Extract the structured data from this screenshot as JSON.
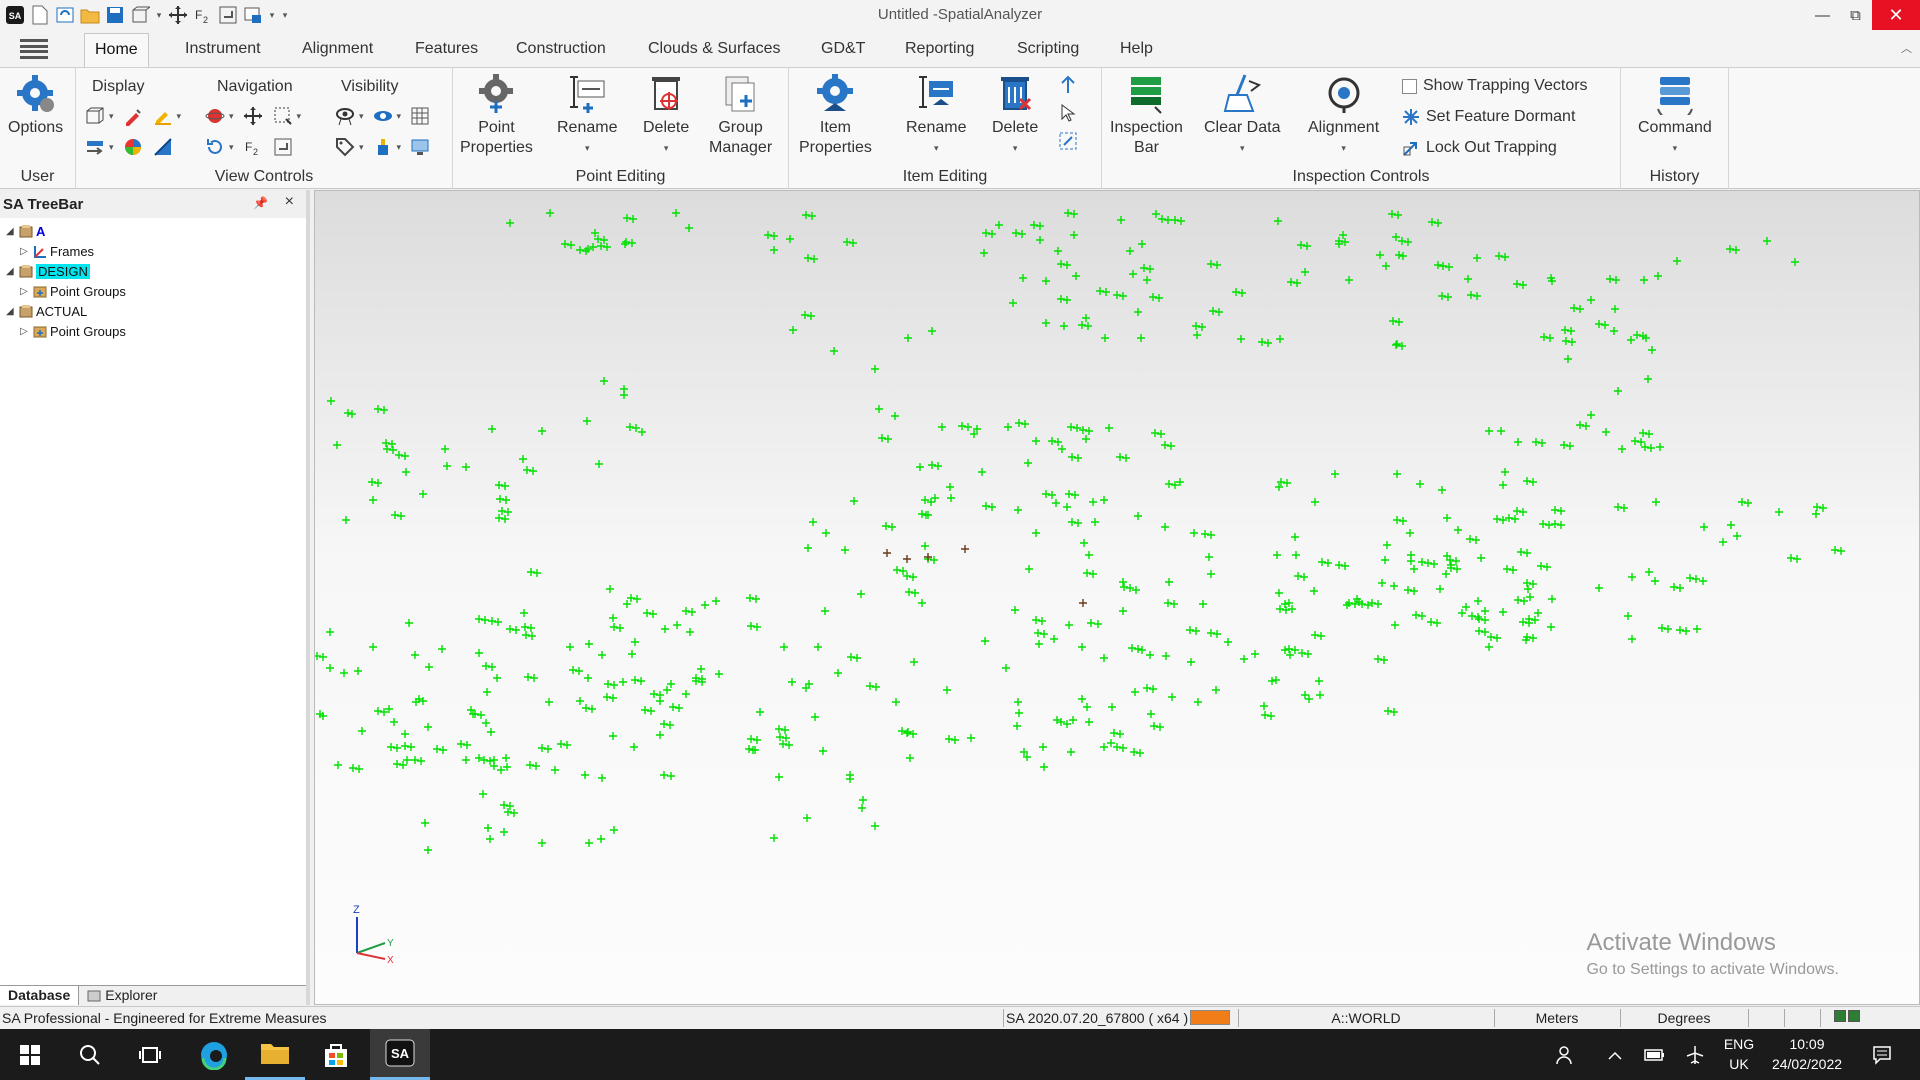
{
  "window": {
    "title": "Untitled -SpatialAnalyzer",
    "close_glyph": "✕",
    "max_glyph": "⧉",
    "min_glyph": "—"
  },
  "tabs": [
    "Home",
    "Instrument",
    "Alignment",
    "Features",
    "Construction",
    "Clouds & Surfaces",
    "GD&T",
    "Reporting",
    "Scripting",
    "Help"
  ],
  "ribbon": {
    "user": {
      "options": "Options",
      "group": "User"
    },
    "view_controls": {
      "display": "Display",
      "navigation": "Navigation",
      "visibility": "Visibility",
      "group": "View Controls"
    },
    "point_editing": {
      "point_properties_1": "Point",
      "point_properties_2": "Properties",
      "rename": "Rename",
      "delete": "Delete",
      "group_manager_1": "Group",
      "group_manager_2": "Manager",
      "group": "Point Editing"
    },
    "item_editing": {
      "item_properties_1": "Item",
      "item_properties_2": "Properties",
      "rename": "Rename",
      "delete": "Delete",
      "group": "Item Editing"
    },
    "inspection": {
      "inspection_bar_1": "Inspection",
      "inspection_bar_2": "Bar",
      "clear_data": "Clear Data",
      "alignment": "Alignment",
      "show_trapping": "Show Trapping Vectors",
      "set_dormant": "Set Feature Dormant",
      "lock_out": "Lock Out Trapping",
      "group": "Inspection Controls"
    },
    "history": {
      "command": "Command",
      "group": "History"
    }
  },
  "treebar": {
    "title": "SA TreeBar",
    "nodes": [
      "A",
      "Frames",
      "DESIGN",
      "Point Groups",
      "ACTUAL",
      "Point Groups"
    ],
    "tabs": [
      "Database",
      "Explorer"
    ]
  },
  "viewport": {
    "activate_title": "Activate Windows",
    "activate_sub": "Go to Settings to activate Windows.",
    "axis_labels": {
      "z": "Z",
      "y": "Y",
      "x": "X"
    },
    "point_color": "#00e000",
    "highlight_color": "#6b3a1a"
  },
  "statusbar": {
    "left": "SA Professional - Engineered for Extreme Measures",
    "version": "SA 2020.07.20_67800 ( x64 )",
    "frame": "A::WORLD",
    "units": "Meters",
    "angles": "Degrees"
  },
  "taskbar": {
    "lang_1": "ENG",
    "lang_2": "UK",
    "time": "10:09",
    "date": "24/02/2022"
  }
}
